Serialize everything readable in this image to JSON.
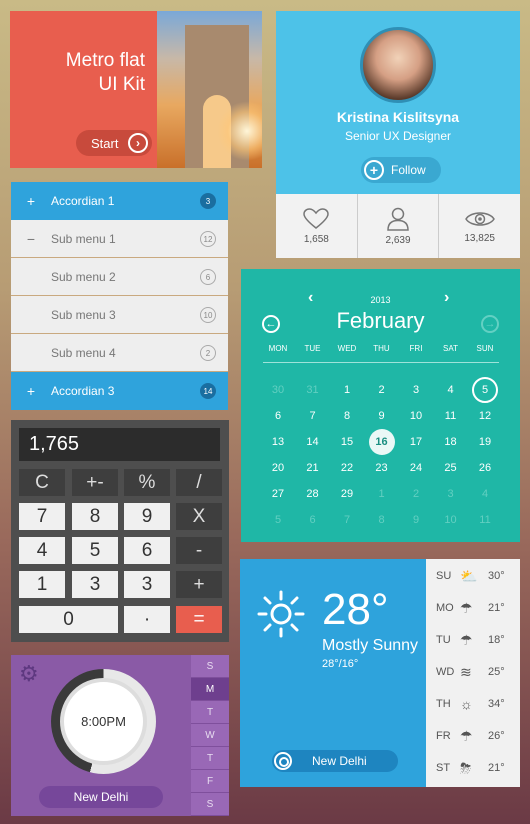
{
  "hero": {
    "title_line1": "Metro flat",
    "title_line2": "UI Kit",
    "start": "Start",
    "start_icon": "chevron-right-icon"
  },
  "profile": {
    "name": "Kristina Kislitsyna",
    "role": "Senior UX Designer",
    "follow": "Follow",
    "stats": [
      {
        "icon": "heart-icon",
        "value": "1,658"
      },
      {
        "icon": "user-icon",
        "value": "2,639"
      },
      {
        "icon": "eye-icon",
        "value": "13,825"
      }
    ]
  },
  "accordion": {
    "items": [
      {
        "sign": "+",
        "label": "Accordian 1",
        "count": "3",
        "type": "head"
      },
      {
        "sign": "−",
        "label": "Sub menu 1",
        "count": "12",
        "type": "sub"
      },
      {
        "sign": "",
        "label": "Sub menu 2",
        "count": "6",
        "type": "sub"
      },
      {
        "sign": "",
        "label": "Sub menu 3",
        "count": "10",
        "type": "sub"
      },
      {
        "sign": "",
        "label": "Sub menu 4",
        "count": "2",
        "type": "sub"
      },
      {
        "sign": "+",
        "label": "Accordian 3",
        "count": "14",
        "type": "head"
      }
    ]
  },
  "calculator": {
    "display": "1,765",
    "keys": [
      "C",
      "+-",
      "%",
      "/",
      "7",
      "8",
      "9",
      "X",
      "4",
      "5",
      "6",
      "-",
      "1",
      "3",
      "3",
      "+",
      "0",
      "·",
      "="
    ]
  },
  "clock": {
    "time": "8:00PM",
    "city": "New Delhi",
    "days": [
      "S",
      "M",
      "T",
      "W",
      "T",
      "F",
      "S"
    ],
    "selected_day": 1
  },
  "calendar": {
    "year": "2013",
    "month": "February",
    "weekdays": [
      "MON",
      "TUE",
      "WED",
      "THU",
      "FRI",
      "SAT",
      "SUN"
    ],
    "weeks": [
      [
        "30",
        "31",
        "1",
        "2",
        "3",
        "4",
        "5"
      ],
      [
        "6",
        "7",
        "8",
        "9",
        "10",
        "11",
        "12"
      ],
      [
        "13",
        "14",
        "15",
        "16",
        "17",
        "18",
        "19"
      ],
      [
        "20",
        "21",
        "22",
        "23",
        "24",
        "25",
        "26"
      ],
      [
        "27",
        "28",
        "29",
        "1",
        "2",
        "3",
        "4"
      ],
      [
        "5",
        "6",
        "7",
        "8",
        "9",
        "10",
        "11"
      ]
    ],
    "today": "16",
    "highlight": "5"
  },
  "weather": {
    "temp": "28°",
    "condition": "Mostly Sunny",
    "range": "28°/16°",
    "city": "New Delhi",
    "forecast": [
      {
        "day": "SU",
        "icon": "partly-cloudy-icon",
        "temp": "30°"
      },
      {
        "day": "MO",
        "icon": "rain-icon",
        "temp": "21°"
      },
      {
        "day": "TU",
        "icon": "rain-icon",
        "temp": "18°"
      },
      {
        "day": "WD",
        "icon": "fog-icon",
        "temp": "25°"
      },
      {
        "day": "TH",
        "icon": "sun-icon",
        "temp": "34°"
      },
      {
        "day": "FR",
        "icon": "rain-icon",
        "temp": "26°"
      },
      {
        "day": "ST",
        "icon": "storm-icon",
        "temp": "21°"
      }
    ]
  }
}
